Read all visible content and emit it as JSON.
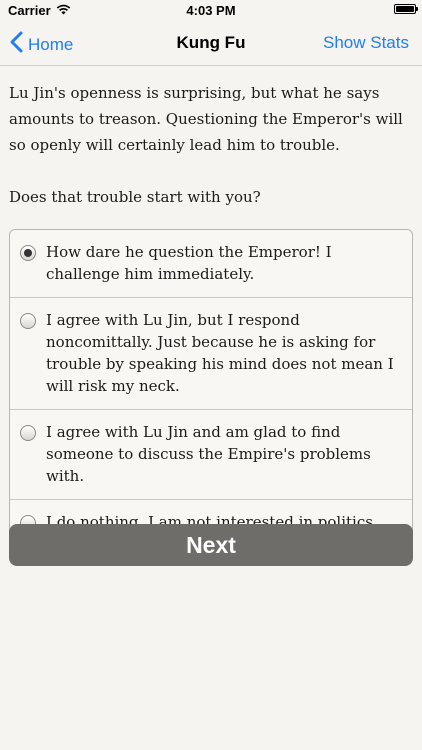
{
  "status_bar": {
    "carrier": "Carrier",
    "wifi_icon": "wifi-icon",
    "time": "4:03 PM",
    "battery_icon": "battery-icon"
  },
  "nav": {
    "back_label": "Home",
    "title": "Kung Fu",
    "right_label": "Show Stats",
    "accent_color": "#1f7ef4"
  },
  "story": {
    "paragraphs": [
      "Lu Jin's openness is surprising, but what he says amounts to treason. Questioning the Emperor's will so openly will certainly lead him to trouble.",
      "Does that trouble start with you?"
    ]
  },
  "choices": [
    {
      "label": "How dare he question the Emperor! I challenge him immediately.",
      "selected": true
    },
    {
      "label": "I agree with Lu Jin, but I respond noncomittally. Just because he is asking for trouble by speaking his mind does not mean I will risk my neck.",
      "selected": false
    },
    {
      "label": "I agree with Lu Jin and am glad to find someone to discuss the Empire's problems with.",
      "selected": false
    },
    {
      "label": "I do nothing. I am not interested in politics.",
      "selected": false
    }
  ],
  "next_button": {
    "label": "Next"
  }
}
